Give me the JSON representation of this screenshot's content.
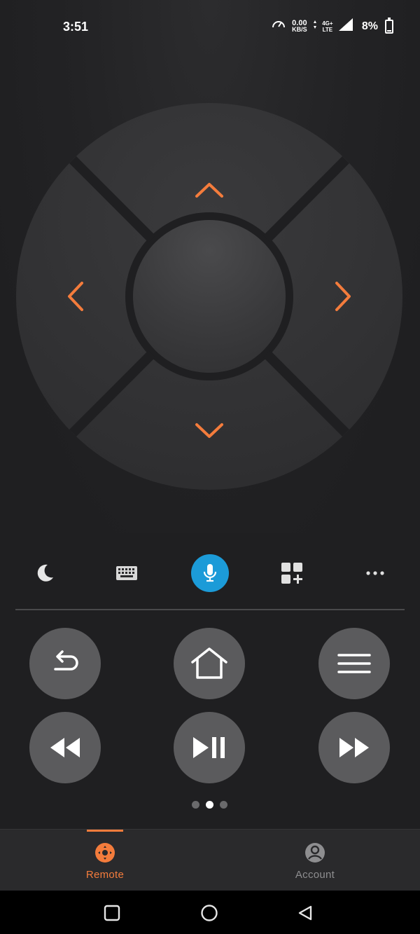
{
  "status_bar": {
    "time": "3:51",
    "net_speed_value": "0.00",
    "net_speed_unit": "KB/S",
    "network_type_top": "4G+",
    "network_type_bottom": "LTE",
    "battery": "8%"
  },
  "dpad": {
    "up_icon": "chevron-up-icon",
    "down_icon": "chevron-down-icon",
    "left_icon": "chevron-left-icon",
    "right_icon": "chevron-right-icon",
    "accent_color": "#f47c3c"
  },
  "toolbar": {
    "items": [
      "moon-icon",
      "keyboard-icon",
      "microphone-icon",
      "apps-add-icon",
      "more-dots-icon"
    ],
    "mic_color": "#1c9bd8"
  },
  "controls": {
    "row1": [
      "back-icon",
      "home-icon",
      "menu-icon"
    ],
    "row2": [
      "rewind-icon",
      "play-pause-icon",
      "fast-forward-icon"
    ]
  },
  "pager": {
    "count": 3,
    "active_index": 1
  },
  "bottom_nav": {
    "items": [
      {
        "label": "Remote",
        "icon": "remote-icon",
        "active": true
      },
      {
        "label": "Account",
        "icon": "account-icon",
        "active": false
      }
    ]
  },
  "system_nav": [
    "recents-icon",
    "home-circle-icon",
    "back-triangle-icon"
  ]
}
